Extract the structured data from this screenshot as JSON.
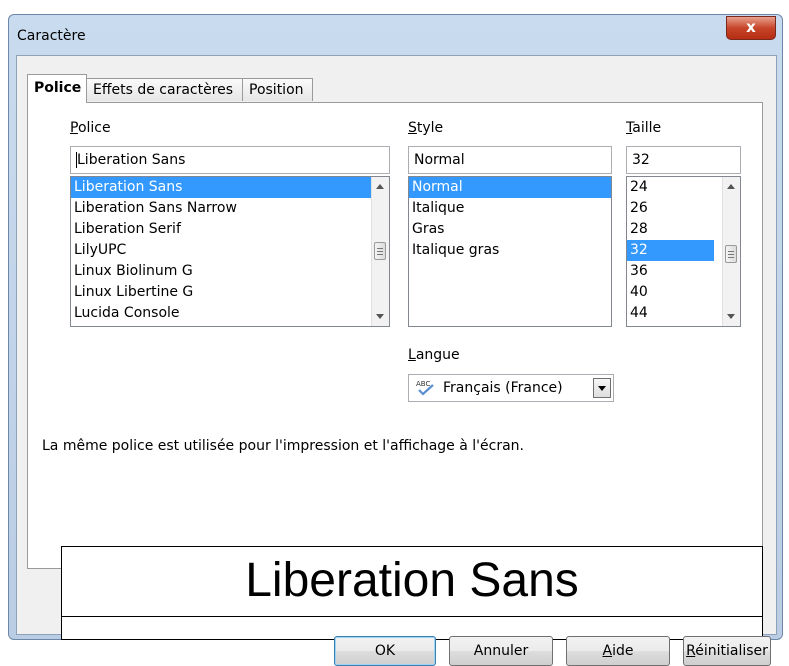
{
  "window": {
    "title": "Caractère",
    "close_glyph": "x"
  },
  "tabs": [
    {
      "label": "Police",
      "active": true
    },
    {
      "label": "Effets de caractères",
      "active": false
    },
    {
      "label": "Position",
      "active": false
    }
  ],
  "font": {
    "label_accel": "P",
    "label_rest": "olice",
    "value": "Liberation Sans",
    "items": [
      {
        "label": "Liberation Sans",
        "selected": true
      },
      {
        "label": "Liberation Sans Narrow",
        "selected": false
      },
      {
        "label": "Liberation Serif",
        "selected": false
      },
      {
        "label": "LilyUPC",
        "selected": false
      },
      {
        "label": "Linux Biolinum G",
        "selected": false
      },
      {
        "label": "Linux Libertine G",
        "selected": false
      },
      {
        "label": "Lucida Console",
        "selected": false
      }
    ]
  },
  "style": {
    "label_accel": "S",
    "label_rest": "tyle",
    "value": "Normal",
    "items": [
      {
        "label": "Normal",
        "selected": true
      },
      {
        "label": "Italique",
        "selected": false
      },
      {
        "label": "Gras",
        "selected": false
      },
      {
        "label": "Italique gras",
        "selected": false
      }
    ]
  },
  "size": {
    "label_accel": "T",
    "label_rest": "aille",
    "value": "32",
    "items": [
      {
        "label": "24",
        "selected": false
      },
      {
        "label": "26",
        "selected": false
      },
      {
        "label": "28",
        "selected": false
      },
      {
        "label": "32",
        "selected": true
      },
      {
        "label": "36",
        "selected": false
      },
      {
        "label": "40",
        "selected": false
      },
      {
        "label": "44",
        "selected": false
      }
    ]
  },
  "language": {
    "label_accel": "L",
    "label_rest": "angue",
    "value": "Français (France)",
    "icon": "spellcheck-abc-icon"
  },
  "info_text": "La même police est utilisée pour l'impression et l'affichage à l'écran.",
  "preview_text": "Liberation Sans",
  "buttons": {
    "ok": "OK",
    "cancel": "Annuler",
    "help_accel": "A",
    "help_rest": "ide",
    "reset_accel": "R",
    "reset_rest": "éinitialiser"
  },
  "colors": {
    "selection": "#3399ff",
    "title_bar": "#c9dbee",
    "close_button": "#c7452a"
  }
}
